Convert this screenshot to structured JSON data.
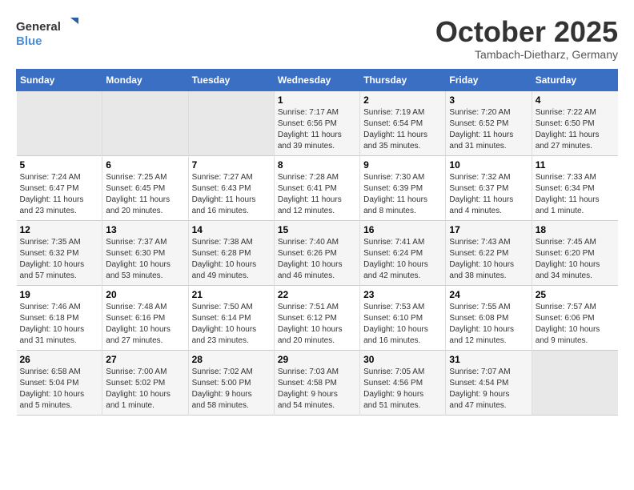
{
  "logo": {
    "line1": "General",
    "line2": "Blue"
  },
  "title": "October 2025",
  "subtitle": "Tambach-Dietharz, Germany",
  "days_of_week": [
    "Sunday",
    "Monday",
    "Tuesday",
    "Wednesday",
    "Thursday",
    "Friday",
    "Saturday"
  ],
  "weeks": [
    [
      {
        "day": "",
        "empty": true
      },
      {
        "day": "",
        "empty": true
      },
      {
        "day": "",
        "empty": true
      },
      {
        "day": "1",
        "info": "Sunrise: 7:17 AM\nSunset: 6:56 PM\nDaylight: 11 hours\nand 39 minutes."
      },
      {
        "day": "2",
        "info": "Sunrise: 7:19 AM\nSunset: 6:54 PM\nDaylight: 11 hours\nand 35 minutes."
      },
      {
        "day": "3",
        "info": "Sunrise: 7:20 AM\nSunset: 6:52 PM\nDaylight: 11 hours\nand 31 minutes."
      },
      {
        "day": "4",
        "info": "Sunrise: 7:22 AM\nSunset: 6:50 PM\nDaylight: 11 hours\nand 27 minutes."
      }
    ],
    [
      {
        "day": "5",
        "info": "Sunrise: 7:24 AM\nSunset: 6:47 PM\nDaylight: 11 hours\nand 23 minutes."
      },
      {
        "day": "6",
        "info": "Sunrise: 7:25 AM\nSunset: 6:45 PM\nDaylight: 11 hours\nand 20 minutes."
      },
      {
        "day": "7",
        "info": "Sunrise: 7:27 AM\nSunset: 6:43 PM\nDaylight: 11 hours\nand 16 minutes."
      },
      {
        "day": "8",
        "info": "Sunrise: 7:28 AM\nSunset: 6:41 PM\nDaylight: 11 hours\nand 12 minutes."
      },
      {
        "day": "9",
        "info": "Sunrise: 7:30 AM\nSunset: 6:39 PM\nDaylight: 11 hours\nand 8 minutes."
      },
      {
        "day": "10",
        "info": "Sunrise: 7:32 AM\nSunset: 6:37 PM\nDaylight: 11 hours\nand 4 minutes."
      },
      {
        "day": "11",
        "info": "Sunrise: 7:33 AM\nSunset: 6:34 PM\nDaylight: 11 hours\nand 1 minute."
      }
    ],
    [
      {
        "day": "12",
        "info": "Sunrise: 7:35 AM\nSunset: 6:32 PM\nDaylight: 10 hours\nand 57 minutes."
      },
      {
        "day": "13",
        "info": "Sunrise: 7:37 AM\nSunset: 6:30 PM\nDaylight: 10 hours\nand 53 minutes."
      },
      {
        "day": "14",
        "info": "Sunrise: 7:38 AM\nSunset: 6:28 PM\nDaylight: 10 hours\nand 49 minutes."
      },
      {
        "day": "15",
        "info": "Sunrise: 7:40 AM\nSunset: 6:26 PM\nDaylight: 10 hours\nand 46 minutes."
      },
      {
        "day": "16",
        "info": "Sunrise: 7:41 AM\nSunset: 6:24 PM\nDaylight: 10 hours\nand 42 minutes."
      },
      {
        "day": "17",
        "info": "Sunrise: 7:43 AM\nSunset: 6:22 PM\nDaylight: 10 hours\nand 38 minutes."
      },
      {
        "day": "18",
        "info": "Sunrise: 7:45 AM\nSunset: 6:20 PM\nDaylight: 10 hours\nand 34 minutes."
      }
    ],
    [
      {
        "day": "19",
        "info": "Sunrise: 7:46 AM\nSunset: 6:18 PM\nDaylight: 10 hours\nand 31 minutes."
      },
      {
        "day": "20",
        "info": "Sunrise: 7:48 AM\nSunset: 6:16 PM\nDaylight: 10 hours\nand 27 minutes."
      },
      {
        "day": "21",
        "info": "Sunrise: 7:50 AM\nSunset: 6:14 PM\nDaylight: 10 hours\nand 23 minutes."
      },
      {
        "day": "22",
        "info": "Sunrise: 7:51 AM\nSunset: 6:12 PM\nDaylight: 10 hours\nand 20 minutes."
      },
      {
        "day": "23",
        "info": "Sunrise: 7:53 AM\nSunset: 6:10 PM\nDaylight: 10 hours\nand 16 minutes."
      },
      {
        "day": "24",
        "info": "Sunrise: 7:55 AM\nSunset: 6:08 PM\nDaylight: 10 hours\nand 12 minutes."
      },
      {
        "day": "25",
        "info": "Sunrise: 7:57 AM\nSunset: 6:06 PM\nDaylight: 10 hours\nand 9 minutes."
      }
    ],
    [
      {
        "day": "26",
        "info": "Sunrise: 6:58 AM\nSunset: 5:04 PM\nDaylight: 10 hours\nand 5 minutes."
      },
      {
        "day": "27",
        "info": "Sunrise: 7:00 AM\nSunset: 5:02 PM\nDaylight: 10 hours\nand 1 minute."
      },
      {
        "day": "28",
        "info": "Sunrise: 7:02 AM\nSunset: 5:00 PM\nDaylight: 9 hours\nand 58 minutes."
      },
      {
        "day": "29",
        "info": "Sunrise: 7:03 AM\nSunset: 4:58 PM\nDaylight: 9 hours\nand 54 minutes."
      },
      {
        "day": "30",
        "info": "Sunrise: 7:05 AM\nSunset: 4:56 PM\nDaylight: 9 hours\nand 51 minutes."
      },
      {
        "day": "31",
        "info": "Sunrise: 7:07 AM\nSunset: 4:54 PM\nDaylight: 9 hours\nand 47 minutes."
      },
      {
        "day": "",
        "empty": true
      }
    ]
  ]
}
